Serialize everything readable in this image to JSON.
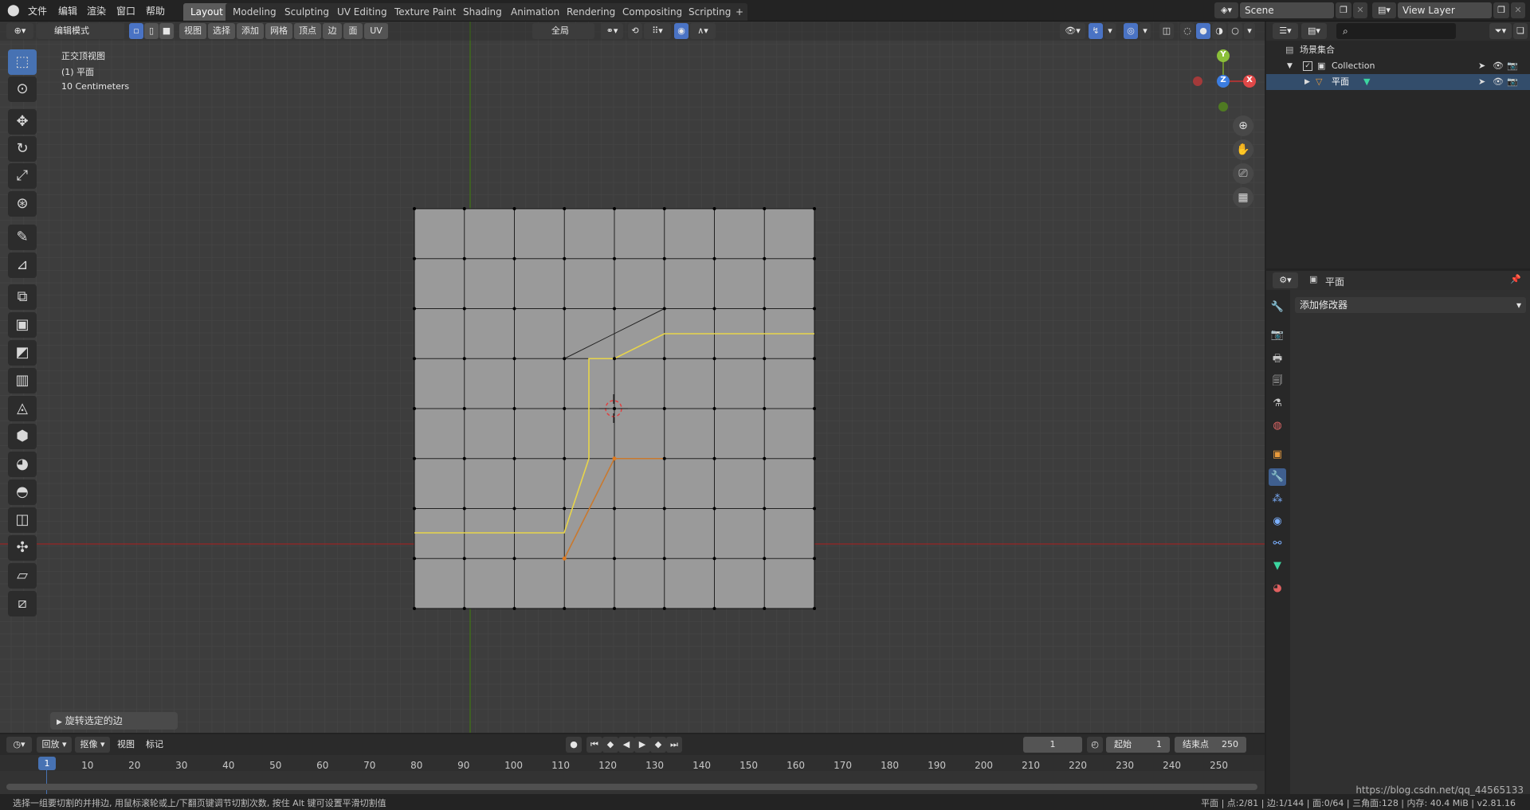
{
  "topbar": {
    "menus": [
      "文件",
      "编辑",
      "渲染",
      "窗口",
      "帮助"
    ],
    "workspaces": [
      "Layout",
      "Modeling",
      "Sculpting",
      "UV Editing",
      "Texture Paint",
      "Shading",
      "Animation",
      "Rendering",
      "Compositing",
      "Scripting"
    ],
    "active_workspace": "Layout",
    "add_tab": "+",
    "scene": "Scene",
    "view_layer": "View Layer"
  },
  "viewport_header": {
    "mode": "编辑模式",
    "menus": [
      "视图",
      "选择",
      "添加",
      "网格",
      "顶点",
      "边",
      "面",
      "UV"
    ],
    "orientation": "全局"
  },
  "viewport_overlay": {
    "view_name": "正交顶视图",
    "object_name": "(1) 平面",
    "scale": "10 Centimeters"
  },
  "gizmo": {
    "y": "Y",
    "z": "Z",
    "x": "X"
  },
  "operator_panel": {
    "label": "旋转选定的边"
  },
  "outliner": {
    "root": "场景集合",
    "collection": "Collection",
    "object": "平面"
  },
  "properties": {
    "object_name": "平面",
    "add_modifier": "添加修改器"
  },
  "timeline": {
    "playback": "回放",
    "keying": "抠像",
    "view": "视图",
    "marker": "标记",
    "current_frame": "1",
    "start_label": "起始",
    "start": "1",
    "end_label": "结束点",
    "end": "250",
    "ticks": [
      "1",
      "10",
      "20",
      "30",
      "40",
      "50",
      "60",
      "70",
      "80",
      "90",
      "100",
      "110",
      "120",
      "130",
      "140",
      "150",
      "160",
      "170",
      "180",
      "190",
      "200",
      "210",
      "220",
      "230",
      "240",
      "250"
    ]
  },
  "statusbar": {
    "hint": "选择一组要切割的并排边, 用鼠标滚轮或上/下翻页键调节切割次数, 按住 Alt 键可设置平滑切割值",
    "stats": "平面 | 点:2/81 | 边:1/144 | 面:0/64 | 三角面:128 | 内存: 40.4 MiB | v2.81.16",
    "watermark": "https://blog.csdn.net/qq_44565133"
  },
  "colors": {
    "accent": "#4772b3",
    "edge_select": "#e8d54a",
    "edge_active": "#c8792e",
    "axis_x": "#8a2a2a",
    "axis_y": "#3f6d1a"
  }
}
